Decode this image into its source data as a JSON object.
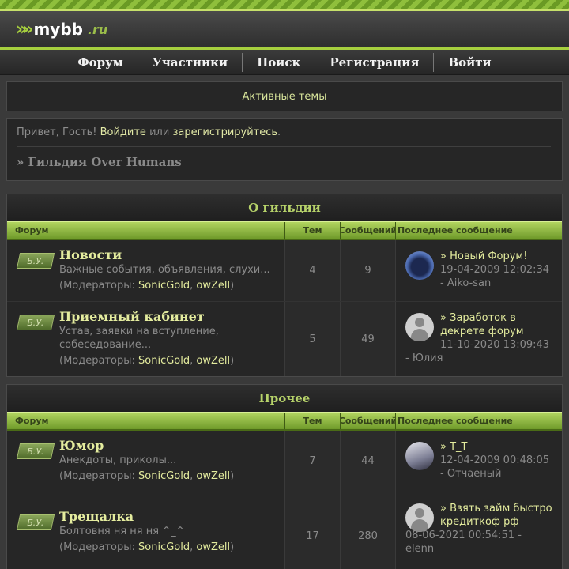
{
  "logo": {
    "text": "mybb",
    "tld": ".ru"
  },
  "nav": [
    "Форум",
    "Участники",
    "Поиск",
    "Регистрация",
    "Войти"
  ],
  "active_topics": "Активные темы",
  "greeting": {
    "prefix": "Привет, Гость!",
    "login": "Войдите",
    "or": "или",
    "register": "зарегистрируйтесь",
    "suffix": "."
  },
  "breadcrumb": "» Гильдия Over Humans",
  "columns": {
    "forum": "Форум",
    "topics": "Тем",
    "posts": "Сообщений",
    "last": "Последнее сообщение"
  },
  "categories": [
    {
      "title": "О гильдии",
      "forums": [
        {
          "badge": "Б.У.",
          "name": "Новости",
          "desc": "Важные события, объявления, слухи...",
          "mods_label": "(Модераторы:",
          "mods": [
            "SonicGold",
            "owZell"
          ],
          "topics": "4",
          "posts": "9",
          "last": {
            "title": "Новый Форум!",
            "date": "19-04-2009 12:02:34",
            "author": "- Aiko-san"
          }
        },
        {
          "badge": "Б.У.",
          "name": "Приемный кабинет",
          "desc": "Устав, заявки на вступление, собеседование...",
          "mods_label": "(Модераторы:",
          "mods": [
            "SonicGold",
            "owZell"
          ],
          "topics": "5",
          "posts": "49",
          "last": {
            "title": "Заработок в декрете форум",
            "date": "11-10-2020 13:09:43",
            "author": "- Юлия"
          }
        }
      ]
    },
    {
      "title": "Прочее",
      "forums": [
        {
          "badge": "Б.У.",
          "name": "Юмор",
          "desc": "Анекдоты, приколы...",
          "mods_label": "(Модераторы:",
          "mods": [
            "SonicGold",
            "owZell"
          ],
          "topics": "7",
          "posts": "44",
          "last": {
            "title": "T_T",
            "date": "12-04-2009 00:48:05",
            "author": "- Отчаеный"
          }
        },
        {
          "badge": "Б.У.",
          "name": "Трещалка",
          "desc": "Болтовня ня ня ня ^_^",
          "mods_label": "(Модераторы:",
          "mods": [
            "SonicGold",
            "owZell"
          ],
          "topics": "17",
          "posts": "280",
          "last": {
            "title": "Взять займ быстро кредиткоф рф",
            "date": "08-06-2021 00:54:51 -",
            "author": "elenn"
          }
        }
      ]
    }
  ]
}
